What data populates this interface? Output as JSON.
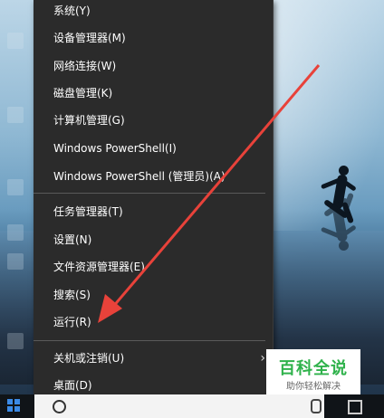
{
  "menu": {
    "items": [
      {
        "label": "系统(Y)"
      },
      {
        "label": "设备管理器(M)"
      },
      {
        "label": "网络连接(W)"
      },
      {
        "label": "磁盘管理(K)"
      },
      {
        "label": "计算机管理(G)"
      },
      {
        "label": "Windows PowerShell(I)"
      },
      {
        "label": "Windows PowerShell (管理员)(A)"
      },
      {
        "label": "任务管理器(T)"
      },
      {
        "label": "设置(N)"
      },
      {
        "label": "文件资源管理器(E)"
      },
      {
        "label": "搜索(S)"
      },
      {
        "label": "运行(R)"
      },
      {
        "label": "关机或注销(U)"
      },
      {
        "label": "桌面(D)"
      }
    ]
  },
  "watermark": {
    "title": "百科全说",
    "subtitle": "助你轻松解决"
  },
  "annotation": {
    "arrow_color": "#e8423a"
  },
  "icons": {
    "start": "windows-start-icon",
    "search": "search-icon",
    "mic": "microphone-icon",
    "task_view": "task-view-icon",
    "submenu": "chevron-right-icon"
  }
}
